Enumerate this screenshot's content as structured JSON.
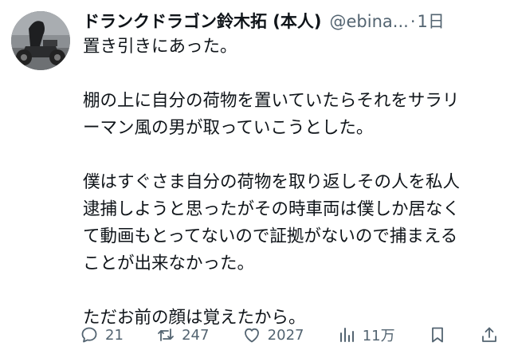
{
  "tweet": {
    "author": {
      "display_name": "ドランクドラゴン鈴木拓 (本人)",
      "handle": "@ebina...",
      "separator": "·",
      "time": "1日"
    },
    "paragraphs": [
      [
        "置き引きにあった。"
      ],
      [
        "棚の上に自分の荷物を置いていたらそれをサラリ",
        "ーマン風の男が取っていこうとした。"
      ],
      [
        "僕はすぐさま自分の荷物を取り返しその人を私人",
        "逮捕しようと思ったがその時車両は僕しか居なく",
        "て動画もとってないので証拠がないので捕まえる",
        "ことが出来なかった。"
      ],
      [
        "ただお前の顔は覚えたから。"
      ]
    ],
    "stats": {
      "replies": "21",
      "reposts": "247",
      "likes": "2027",
      "views": "11万"
    },
    "icons": {
      "reply": "reply-bubble-icon",
      "repost": "repost-arrows-icon",
      "like": "heart-icon",
      "views": "views-bar-chart-icon",
      "bookmark": "bookmark-icon",
      "share": "share-upload-icon"
    },
    "colors": {
      "text": "#0f1419",
      "secondary": "#536471"
    }
  }
}
